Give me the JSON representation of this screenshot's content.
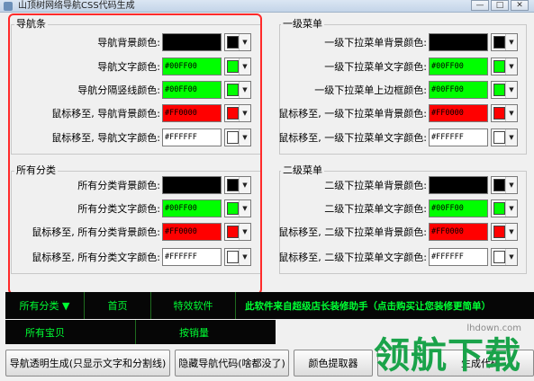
{
  "window": {
    "title": "山顶树网络导航CSS代码生成",
    "controls": [
      "—",
      "□",
      "✕"
    ]
  },
  "sections": {
    "nav": {
      "title": "导航条",
      "rows": [
        {
          "label": "导航背景颜色:",
          "value": "",
          "color": "#000000"
        },
        {
          "label": "导航文字颜色:",
          "value": "#00FF00",
          "color": "#00FF00"
        },
        {
          "label": "导航分隔竖线颜色:",
          "value": "#00FF00",
          "color": "#00FF00"
        },
        {
          "label": "鼠标移至, 导航背景颜色:",
          "value": "#FF0000",
          "color": "#FF0000"
        },
        {
          "label": "鼠标移至, 导航文字颜色:",
          "value": "#FFFFFF",
          "color": "#FFFFFF"
        }
      ]
    },
    "all_categories": {
      "title": "所有分类",
      "rows": [
        {
          "label": "所有分类背景颜色:",
          "value": "",
          "color": "#000000"
        },
        {
          "label": "所有分类文字颜色:",
          "value": "#00FF00",
          "color": "#00FF00"
        },
        {
          "label": "鼠标移至, 所有分类背景颜色:",
          "value": "#FF0000",
          "color": "#FF0000"
        },
        {
          "label": "鼠标移至, 所有分类文字颜色:",
          "value": "#FFFFFF",
          "color": "#FFFFFF"
        }
      ]
    },
    "level1": {
      "title": "一级菜单",
      "rows": [
        {
          "label": "一级下拉菜单背景颜色:",
          "value": "",
          "color": "#000000"
        },
        {
          "label": "一级下拉菜单文字颜色:",
          "value": "#00FF00",
          "color": "#00FF00"
        },
        {
          "label": "一级下拉菜单上边框颜色:",
          "value": "#00FF00",
          "color": "#00FF00"
        },
        {
          "label": "鼠标移至, 一级下拉菜单背景颜色:",
          "value": "#FF0000",
          "color": "#FF0000"
        },
        {
          "label": "鼠标移至, 一级下拉菜单文字颜色:",
          "value": "#FFFFFF",
          "color": "#FFFFFF"
        }
      ]
    },
    "level2": {
      "title": "二级菜单",
      "rows": [
        {
          "label": "二级下拉菜单背景颜色:",
          "value": "",
          "color": "#000000"
        },
        {
          "label": "二级下拉菜单文字颜色:",
          "value": "#00FF00",
          "color": "#00FF00"
        },
        {
          "label": "鼠标移至, 二级下拉菜单背景颜色:",
          "value": "#FF0000",
          "color": "#FF0000"
        },
        {
          "label": "鼠标移至, 二级下拉菜单文字颜色:",
          "value": "#FFFFFF",
          "color": "#FFFFFF"
        }
      ]
    }
  },
  "preview": {
    "nav_items": [
      "所有分类 ▼",
      "首页",
      "特效软件"
    ],
    "promo": "此软件来自超级店长装修助手（点击购买让您装修更简单）",
    "sub_items": [
      "所有宝贝",
      "按销量"
    ],
    "text_color": "#00FF00",
    "background": "#000000"
  },
  "buttons": {
    "transparent": "导航透明生成(只显示文字和分割线)",
    "hide": "隐藏导航代码(啥都没了)",
    "picker": "颜色提取器",
    "generate": "生成代码"
  },
  "watermark": {
    "url": "lhdown.com",
    "text": "领航下载"
  }
}
